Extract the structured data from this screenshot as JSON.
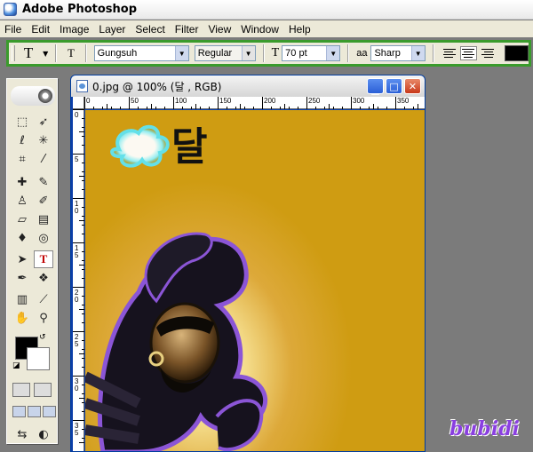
{
  "app": {
    "title": "Adobe Photoshop"
  },
  "menu": {
    "items": [
      "File",
      "Edit",
      "Image",
      "Layer",
      "Select",
      "Filter",
      "View",
      "Window",
      "Help"
    ]
  },
  "options_bar": {
    "tool_icon": "T",
    "orientation_icon": "T",
    "font_family": "Gungsuh",
    "font_style": "Regular",
    "font_size": "70 pt",
    "antialias": "Sharp",
    "size_icon": "T",
    "antialias_icon": "aa",
    "text_color": "#000000"
  },
  "toolbox": {
    "active_tool": "T",
    "foreground_color": "#000000",
    "background_color": "#ffffff"
  },
  "document": {
    "title": "0.jpg @ 100% (달 , RGB)",
    "ruler_h": [
      "0",
      "50",
      "100",
      "150",
      "200",
      "250",
      "300",
      "350"
    ],
    "ruler_v": [
      "0",
      "5",
      "1 0",
      "1 5",
      "2 0",
      "2 5",
      "3 0",
      "3 5"
    ],
    "canvas_text": "달",
    "background_color": "#cf9c12"
  },
  "watermark": "bubidi"
}
